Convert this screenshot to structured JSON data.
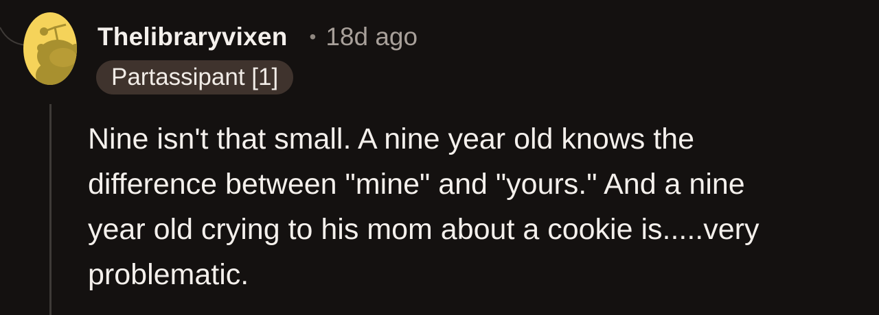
{
  "comment": {
    "username": "Thelibraryvixen",
    "separator": "•",
    "timestamp": "18d ago",
    "flair": "Partassipant [1]",
    "body_lines": [
      "Nine isn't that small. A nine year old knows the",
      "difference between \"mine\" and \"yours.\" And a nine",
      "year old crying to his mom about a cookie is.....very",
      "problematic."
    ],
    "avatar_icon": "snoo-avatar-icon"
  },
  "colors": {
    "background": "#141110",
    "avatar_bg": "#f5d35a",
    "flair_bg": "#3f332d",
    "thread_line": "#3e3a37",
    "muted_text": "#a8a09a"
  }
}
